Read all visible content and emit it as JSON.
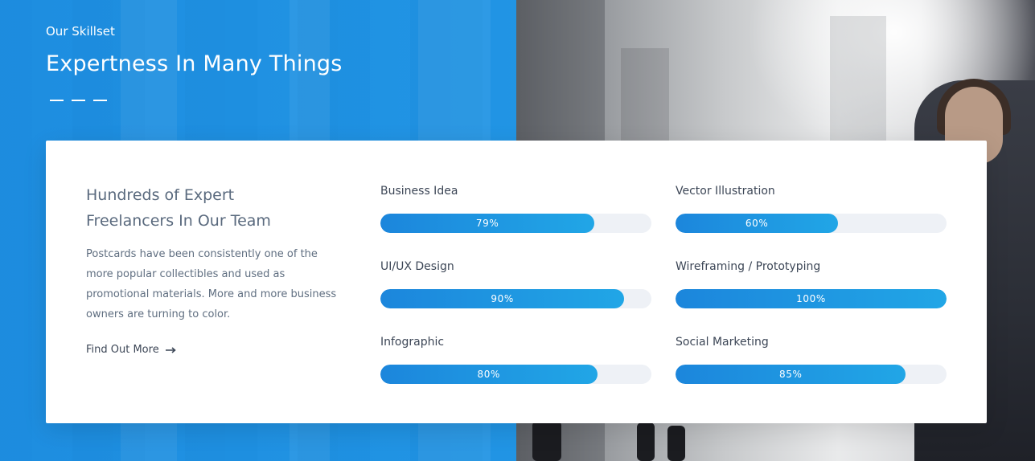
{
  "section": {
    "eyebrow": "Our Skillset",
    "headline": "Expertness In Many Things"
  },
  "card": {
    "title_line1": "Hundreds of Expert",
    "title_line2": "Freelancers In Our Team",
    "text_lines": [
      "Postcards have been consistently one of the",
      "more popular collectibles and used as",
      "promotional materials. More and more business",
      "owners are turning to color."
    ],
    "link_label": "Find Out More"
  },
  "skills": [
    {
      "name": "Business Idea",
      "percent": 79,
      "label": "79%"
    },
    {
      "name": "Vector Illustration",
      "percent": 60,
      "label": "60%"
    },
    {
      "name": "UI/UX Design",
      "percent": 90,
      "label": "90%"
    },
    {
      "name": "Wireframing / Prototyping",
      "percent": 100,
      "label": "100%"
    },
    {
      "name": "Infographic",
      "percent": 80,
      "label": "80%"
    },
    {
      "name": "Social Marketing",
      "percent": 85,
      "label": "85%"
    }
  ],
  "colors": {
    "accent": "#1f9be8",
    "bar_start": "#1c86dc",
    "bar_end": "#21a6e6",
    "track": "#eef1f6",
    "heading_text": "#5a6a7e",
    "body_text": "#3c4656"
  },
  "icons": {
    "link_arrow": "arrow-right-icon"
  }
}
